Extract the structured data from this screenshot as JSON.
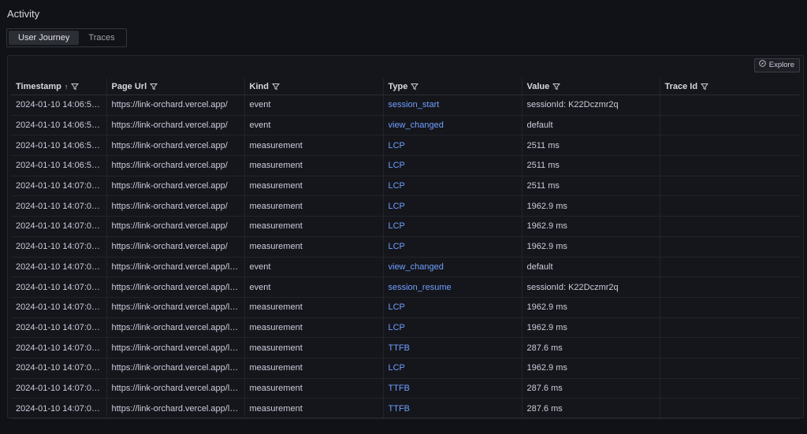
{
  "title": "Activity",
  "tabs": [
    {
      "label": "User Journey",
      "active": true
    },
    {
      "label": "Traces",
      "active": false
    }
  ],
  "explore": {
    "label": "Explore",
    "icon": "compass-icon"
  },
  "columns": [
    {
      "label": "Timestamp",
      "sort": "↑"
    },
    {
      "label": "Page Url"
    },
    {
      "label": "Kind"
    },
    {
      "label": "Type"
    },
    {
      "label": "Value"
    },
    {
      "label": "Trace Id"
    }
  ],
  "rows": [
    {
      "timestamp": "2024-01-10 14:06:55...",
      "page_url": "https://link-orchard.vercel.app/",
      "kind": "event",
      "type": "session_start",
      "value": "sessionId: K22Dczmr2q",
      "trace_id": ""
    },
    {
      "timestamp": "2024-01-10 14:06:55...",
      "page_url": "https://link-orchard.vercel.app/",
      "kind": "event",
      "type": "view_changed",
      "value": "default",
      "trace_id": ""
    },
    {
      "timestamp": "2024-01-10 14:06:55...",
      "page_url": "https://link-orchard.vercel.app/",
      "kind": "measurement",
      "type": "LCP",
      "value": "2511 ms",
      "trace_id": ""
    },
    {
      "timestamp": "2024-01-10 14:06:55...",
      "page_url": "https://link-orchard.vercel.app/",
      "kind": "measurement",
      "type": "LCP",
      "value": "2511 ms",
      "trace_id": ""
    },
    {
      "timestamp": "2024-01-10 14:07:00...",
      "page_url": "https://link-orchard.vercel.app/",
      "kind": "measurement",
      "type": "LCP",
      "value": "2511 ms",
      "trace_id": ""
    },
    {
      "timestamp": "2024-01-10 14:07:00...",
      "page_url": "https://link-orchard.vercel.app/",
      "kind": "measurement",
      "type": "LCP",
      "value": "1962.9 ms",
      "trace_id": ""
    },
    {
      "timestamp": "2024-01-10 14:07:03...",
      "page_url": "https://link-orchard.vercel.app/",
      "kind": "measurement",
      "type": "LCP",
      "value": "1962.9 ms",
      "trace_id": ""
    },
    {
      "timestamp": "2024-01-10 14:07:03...",
      "page_url": "https://link-orchard.vercel.app/",
      "kind": "measurement",
      "type": "LCP",
      "value": "1962.9 ms",
      "trace_id": ""
    },
    {
      "timestamp": "2024-01-10 14:07:03...",
      "page_url": "https://link-orchard.vercel.app/lo...",
      "kind": "event",
      "type": "view_changed",
      "value": "default",
      "trace_id": ""
    },
    {
      "timestamp": "2024-01-10 14:07:03...",
      "page_url": "https://link-orchard.vercel.app/lo...",
      "kind": "event",
      "type": "session_resume",
      "value": "sessionId: K22Dczmr2q",
      "trace_id": ""
    },
    {
      "timestamp": "2024-01-10 14:07:03...",
      "page_url": "https://link-orchard.vercel.app/lo...",
      "kind": "measurement",
      "type": "LCP",
      "value": "1962.9 ms",
      "trace_id": ""
    },
    {
      "timestamp": "2024-01-10 14:07:03...",
      "page_url": "https://link-orchard.vercel.app/lo...",
      "kind": "measurement",
      "type": "LCP",
      "value": "1962.9 ms",
      "trace_id": ""
    },
    {
      "timestamp": "2024-01-10 14:07:04...",
      "page_url": "https://link-orchard.vercel.app/lo...",
      "kind": "measurement",
      "type": "TTFB",
      "value": "287.6 ms",
      "trace_id": ""
    },
    {
      "timestamp": "2024-01-10 14:07:04...",
      "page_url": "https://link-orchard.vercel.app/lo...",
      "kind": "measurement",
      "type": "LCP",
      "value": "1962.9 ms",
      "trace_id": ""
    },
    {
      "timestamp": "2024-01-10 14:07:05...",
      "page_url": "https://link-orchard.vercel.app/lo...",
      "kind": "measurement",
      "type": "TTFB",
      "value": "287.6 ms",
      "trace_id": ""
    },
    {
      "timestamp": "2024-01-10 14:07:05...",
      "page_url": "https://link-orchard.vercel.app/lo...",
      "kind": "measurement",
      "type": "TTFB",
      "value": "287.6 ms",
      "trace_id": ""
    }
  ],
  "colors": {
    "background": "#111217",
    "link": "#6e9fff",
    "text": "#ccccdc"
  }
}
